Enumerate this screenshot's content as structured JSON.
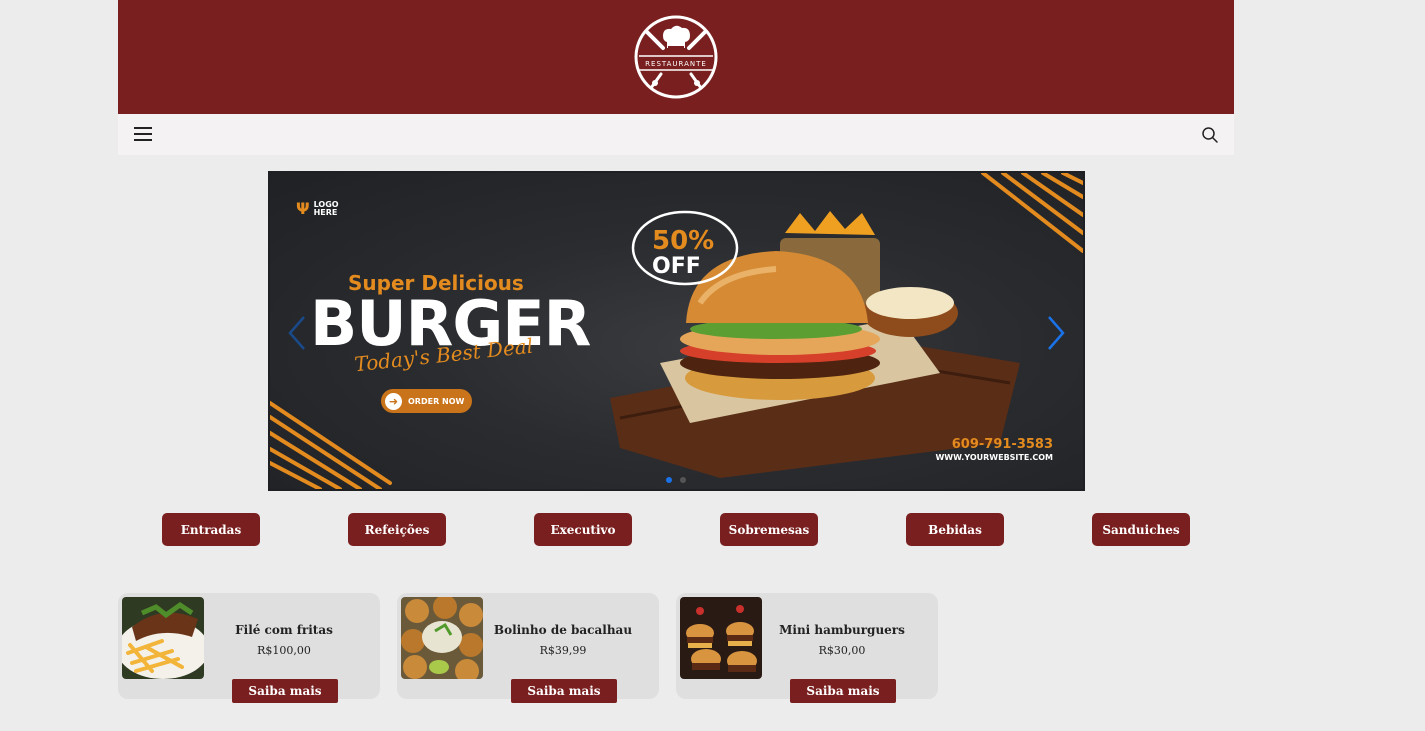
{
  "header": {
    "logo_text": "RESTAURANTE",
    "brand_color": "#7a1f1f"
  },
  "navbar": {
    "menu_icon": "hamburger-menu-icon",
    "search_icon": "search-icon"
  },
  "carousel": {
    "logo_line1": "LOGO",
    "logo_line2": "HERE",
    "tagline": "Super Delicious",
    "title": "BURGER",
    "script_text": "Today's Best Deal",
    "order_button": "ORDER NOW",
    "discount_value": "50%",
    "discount_label": "OFF",
    "phone": "609-791-3583",
    "website": "WWW.YOURWEBSITE.COM",
    "slide_count": 2,
    "active_slide": 1,
    "accent_color": "#e38b1e"
  },
  "categories": [
    "Entradas",
    "Refeições",
    "Executivo",
    "Sobremesas",
    "Bebidas",
    "Sanduiches"
  ],
  "products": [
    {
      "name": "Filé com fritas",
      "price": "R$100,00",
      "button": "Saiba mais",
      "image": "steak-fries-photo"
    },
    {
      "name": "Bolinho de bacalhau",
      "price": "R$39,99",
      "button": "Saiba mais",
      "image": "codfish-balls-photo"
    },
    {
      "name": "Mini hamburguers",
      "price": "R$30,00",
      "button": "Saiba mais",
      "image": "mini-burgers-photo"
    }
  ]
}
